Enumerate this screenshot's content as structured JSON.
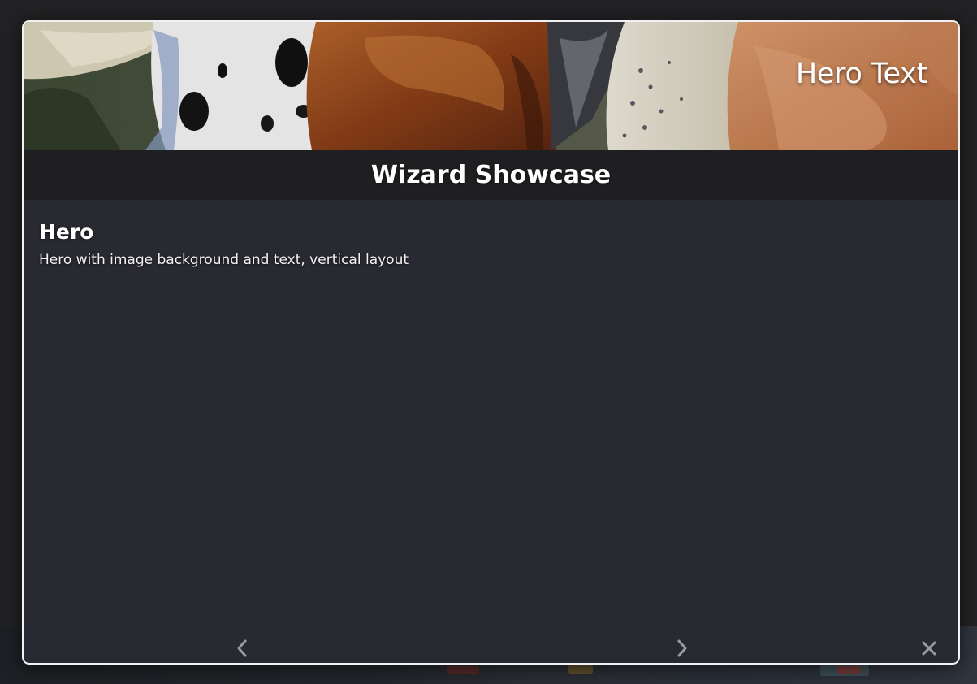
{
  "dialog": {
    "hero": {
      "text": "Hero Text",
      "image": "horses-hero-image"
    },
    "title": "Wizard Showcase",
    "page": {
      "heading": "Hero",
      "description": "Hero with image background and text, vertical layout"
    },
    "nav": {
      "prev_icon": "chevron-left-icon",
      "next_icon": "chevron-right-icon",
      "close_icon": "close-icon"
    }
  },
  "colors": {
    "dialog_background": "#292a31",
    "title_bar_background": "#1f1f21",
    "dialog_border": "#f1f1f3",
    "nav_icon": "#9a9ba1",
    "text": "#ffffff"
  }
}
